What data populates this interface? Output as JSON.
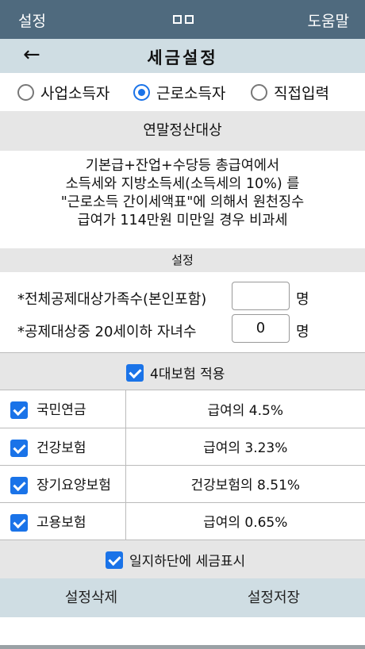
{
  "topbar": {
    "left_label": "설정",
    "right_label": "도움말",
    "center_icon": "window-toggle-icon"
  },
  "titlebar": {
    "back_icon": "back-arrow-icon",
    "title": "세금설정"
  },
  "radio_options": [
    {
      "label": "사업소득자",
      "selected": false
    },
    {
      "label": "근로소득자",
      "selected": true
    },
    {
      "label": "직접입력",
      "selected": false
    }
  ],
  "section_title": "연말정산대상",
  "description": [
    "기본급+잔업+수당등 총급여에서",
    "소득세와 지방소득세(소득세의 10%) 를",
    "\"근로소득 간이세액표\"에 의해서 원천징수",
    "급여가 114만원 미만일 경우 비과세"
  ],
  "settings_title": "설정",
  "fields": [
    {
      "label": "*전체공제대상가족수(본인포함)",
      "value": "",
      "unit": "명"
    },
    {
      "label": "*공제대상중 20세이하 자녀수",
      "value": "0",
      "unit": "명"
    }
  ],
  "four_insurance": {
    "label": "4대보험 적용",
    "checked": true
  },
  "insurances": [
    {
      "name": "국민연금",
      "rate": "급여의 4.5%",
      "checked": true
    },
    {
      "name": "건강보험",
      "rate": "급여의 3.23%",
      "checked": true
    },
    {
      "name": "장기요양보험",
      "rate": "건강보험의 8.51%",
      "checked": true
    },
    {
      "name": "고용보험",
      "rate": "급여의 0.65%",
      "checked": true
    }
  ],
  "show_tax": {
    "label": "일지하단에 세금표시",
    "checked": true
  },
  "actions": {
    "delete_label": "설정삭제",
    "save_label": "설정저장"
  },
  "colors": {
    "topbar": "#4f6a7e",
    "titlebar": "#cfdde3",
    "accent": "#1a73e8",
    "band": "#e6e6e6"
  }
}
